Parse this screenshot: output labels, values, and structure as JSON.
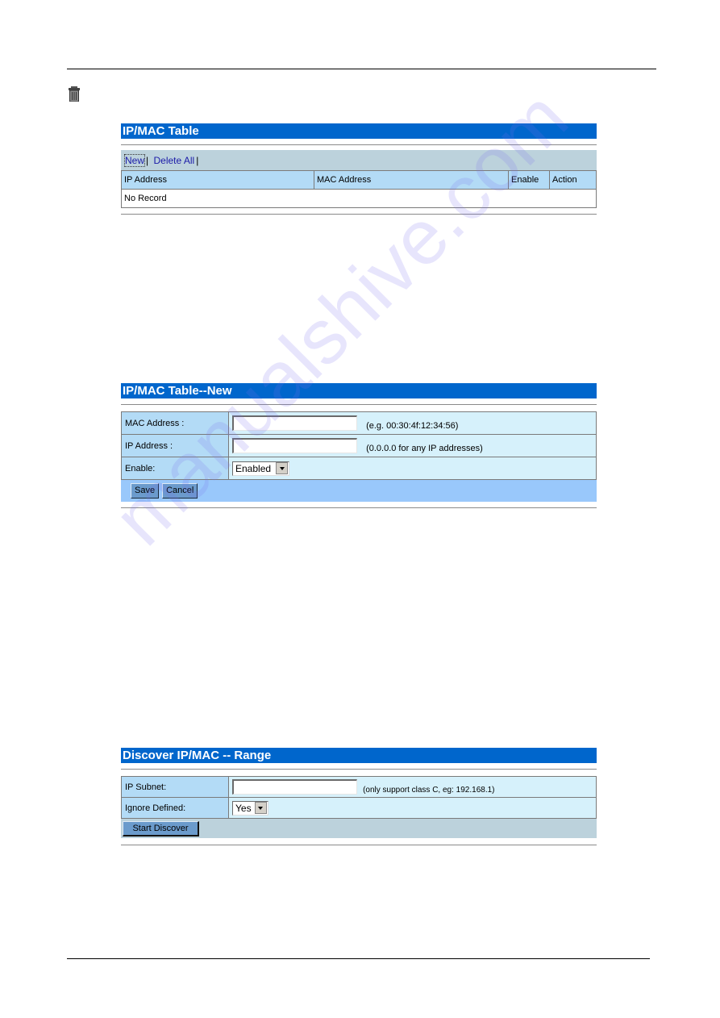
{
  "icons": {
    "page_icon": "trash-icon"
  },
  "watermark": "manualshive.com",
  "ipmac_table": {
    "title": "IP/MAC Table",
    "toolbar": {
      "new_label": "New",
      "delete_all_label": "Delete All",
      "separator": "|"
    },
    "columns": [
      "IP Address",
      "MAC Address",
      "Enable",
      "Action"
    ],
    "rows": [],
    "empty_text": "No Record"
  },
  "ipmac_new": {
    "title": "IP/MAC Table--New",
    "fields": {
      "mac": {
        "label": "MAC Address :",
        "value": "",
        "hint": "(e.g. 00:30:4f:12:34:56)"
      },
      "ip": {
        "label": "IP Address :",
        "value": "",
        "hint": "(0.0.0.0 for any IP addresses)"
      },
      "enable": {
        "label": "Enable:",
        "selected": "Enabled"
      }
    },
    "buttons": {
      "save": "Save",
      "cancel": "Cancel"
    }
  },
  "discover": {
    "title": "Discover IP/MAC -- Range",
    "fields": {
      "subnet": {
        "label": "IP Subnet:",
        "value": "",
        "hint": "(only support class C, eg: 192.168.1)"
      },
      "ignore": {
        "label": "Ignore Defined:",
        "selected": "Yes"
      }
    },
    "buttons": {
      "start": "Start Discover"
    }
  },
  "colors": {
    "title_bar": "#0066cc",
    "header_cell": "#b3dbf6",
    "field_cell": "#d6f1fb",
    "toolbar_bg": "#bcd2dc",
    "button_bar": "#99c8fb",
    "button": "#6b9bcc",
    "link": "#1a1aa8"
  }
}
